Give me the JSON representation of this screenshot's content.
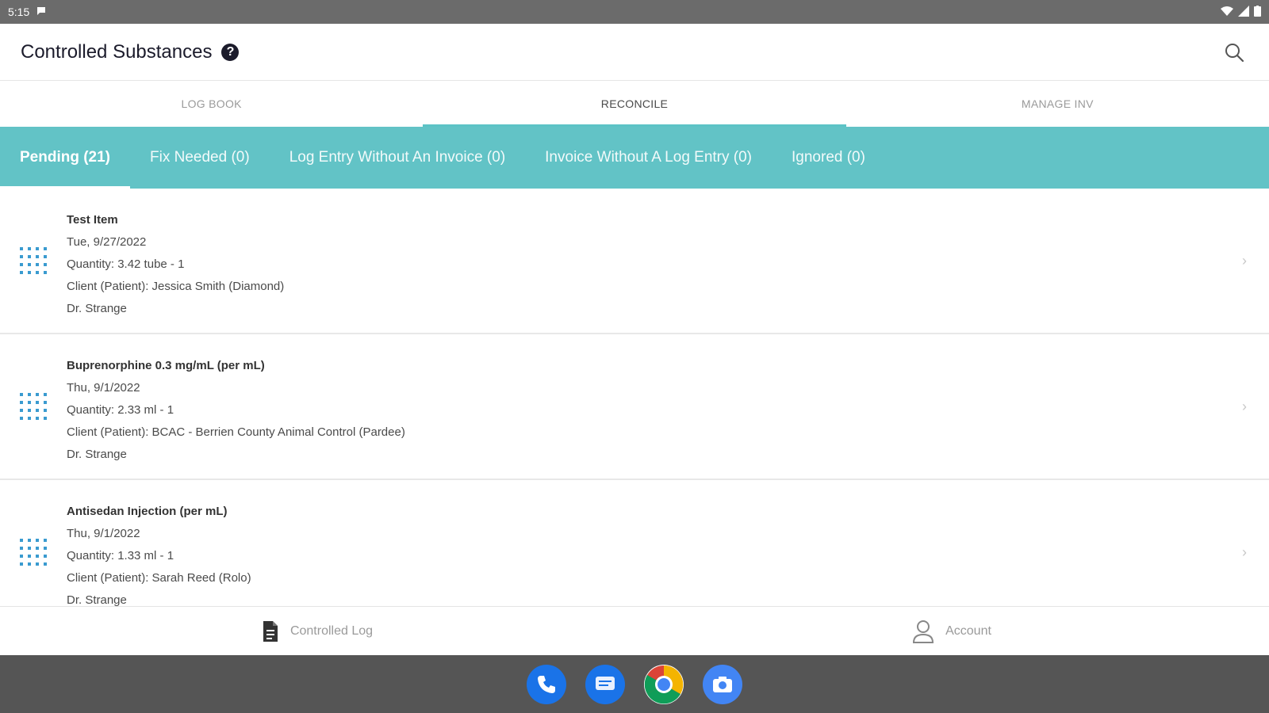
{
  "status_bar": {
    "time": "5:15"
  },
  "app_bar": {
    "title": "Controlled Substances",
    "help_glyph": "?"
  },
  "tabs": [
    {
      "label": "LOG BOOK",
      "active": false
    },
    {
      "label": "RECONCILE",
      "active": true
    },
    {
      "label": "MANAGE INV",
      "active": false
    }
  ],
  "filters": [
    {
      "label": "Pending  (21)",
      "active": true
    },
    {
      "label": "Fix Needed  (0)",
      "active": false
    },
    {
      "label": "Log Entry Without An Invoice  (0)",
      "active": false
    },
    {
      "label": "Invoice Without A Log Entry  (0)",
      "active": false
    },
    {
      "label": "Ignored  (0)",
      "active": false
    }
  ],
  "items": [
    {
      "name": "Test Item",
      "date": "Tue, 9/27/2022",
      "quantity": "Quantity: 3.42 tube - 1",
      "client": "Client (Patient): Jessica Smith (Diamond)",
      "doctor": "Dr. Strange"
    },
    {
      "name": "Buprenorphine 0.3 mg/mL (per mL)",
      "date": "Thu, 9/1/2022",
      "quantity": "Quantity: 2.33 ml - 1",
      "client": "Client (Patient): BCAC - Berrien County Animal Control (Pardee)",
      "doctor": "Dr. Strange"
    },
    {
      "name": "Antisedan Injection (per mL)",
      "date": "Thu, 9/1/2022",
      "quantity": "Quantity: 1.33 ml - 1",
      "client": "Client (Patient): Sarah Reed (Rolo)",
      "doctor": "Dr. Strange"
    }
  ],
  "bottom_nav": [
    {
      "label": "Controlled Log",
      "icon": "document-icon"
    },
    {
      "label": "Account",
      "icon": "person-icon"
    }
  ],
  "dock": [
    {
      "icon": "phone-icon",
      "color": "#1a73e8"
    },
    {
      "icon": "messages-icon",
      "color": "#1a73e8"
    },
    {
      "icon": "chrome-icon",
      "color": "#ffffff"
    },
    {
      "icon": "camera-icon",
      "color": "#4285f4"
    }
  ],
  "colors": {
    "accent": "#62c3c6",
    "status_bar": "#6b6b6b",
    "dock": "#555555",
    "icon_blue": "#3a9bd0"
  }
}
